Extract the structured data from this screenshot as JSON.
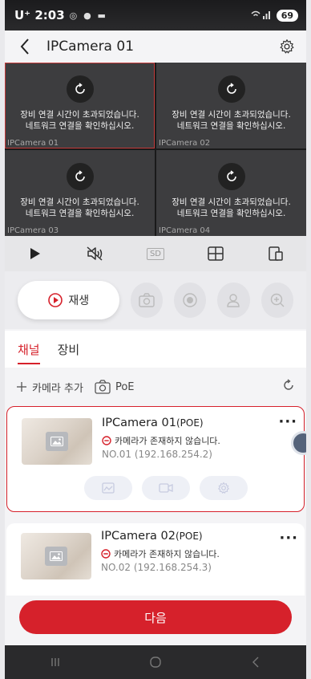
{
  "status_bar": {
    "time": "U⁺ 2:03",
    "battery": "69"
  },
  "header": {
    "title": "IPCamera 01"
  },
  "camera_grid": {
    "tiles": [
      {
        "error_line1": "장비 연결 시간이 초과되었습니다.",
        "error_line2": "네트워크 연결을 확인하십시오.",
        "name": "IPCamera 01",
        "active": true
      },
      {
        "error_line1": "장비 연결 시간이 초과되었습니다.",
        "error_line2": "네트워크 연결을 확인하십시오.",
        "name": "IPCamera 02",
        "active": false
      },
      {
        "error_line1": "장비 연결 시간이 초과되었습니다.",
        "error_line2": "네트워크 연결을 확인하십시오.",
        "name": "IPCamera 03",
        "active": false
      },
      {
        "error_line1": "장비 연결 시간이 초과되었습니다.",
        "error_line2": "네트워크 연결을 확인하십시오.",
        "name": "IPCamera 04",
        "active": false
      }
    ]
  },
  "controls": {
    "quality_label": "SD"
  },
  "actions": {
    "play_label": "재생"
  },
  "tabs": [
    {
      "label": "채널",
      "active": true
    },
    {
      "label": "장비",
      "active": false
    }
  ],
  "toolbar": {
    "add_camera_label": "카메라 추가",
    "poe_label": "PoE"
  },
  "cameras": [
    {
      "name": "IPCamera 01",
      "tag": "(POE)",
      "status": "카메라가 존재하지 않습니다.",
      "address": "NO.01 (192.168.254.2)"
    },
    {
      "name": "IPCamera 02",
      "tag": "(POE)",
      "status": "카메라가 존재하지 않습니다.",
      "address": "NO.02 (192.168.254.3)"
    }
  ],
  "next_button": {
    "label": "다음"
  },
  "colors": {
    "accent": "#d6212b",
    "tile_bg": "#3d3d3f"
  }
}
